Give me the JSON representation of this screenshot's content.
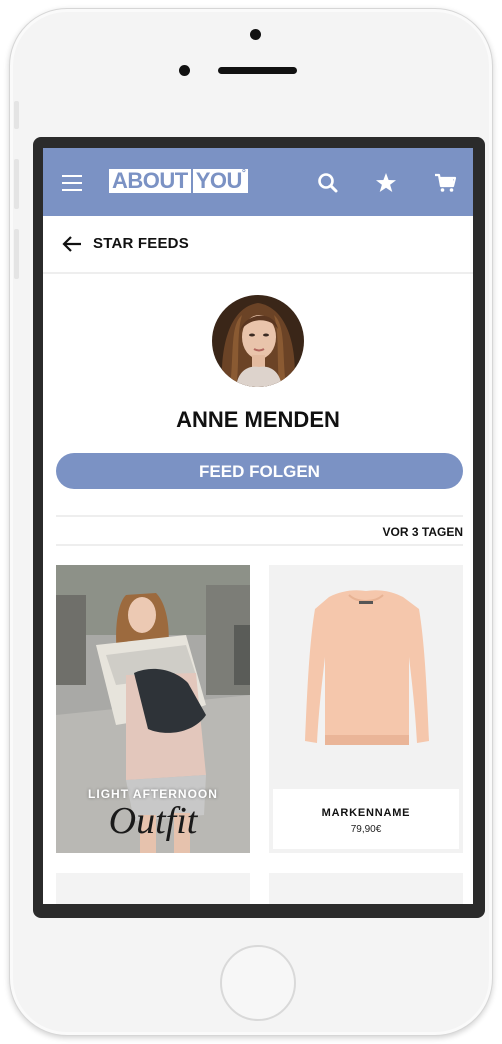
{
  "app": {
    "logo_left": "ABOUT",
    "logo_right": "YOU",
    "logo_mark": "°"
  },
  "toolbar": {
    "icons": [
      "menu-icon",
      "search-icon",
      "star-icon",
      "cart-icon"
    ]
  },
  "header": {
    "title": "STAR FEEDS"
  },
  "profile": {
    "name": "ANNE MENDEN",
    "follow_label": "FEED FOLGEN"
  },
  "feed": {
    "timestamp": "VOR 3 TAGEN",
    "outfit": {
      "line1": "LIGHT AFTERNOON",
      "line2": "Outfit"
    },
    "product": {
      "brand": "MARKENNAME",
      "price": "79,90€"
    }
  },
  "colors": {
    "accent": "#7b92c4",
    "frame": "#2b2b2b",
    "background": "#ffffff"
  }
}
